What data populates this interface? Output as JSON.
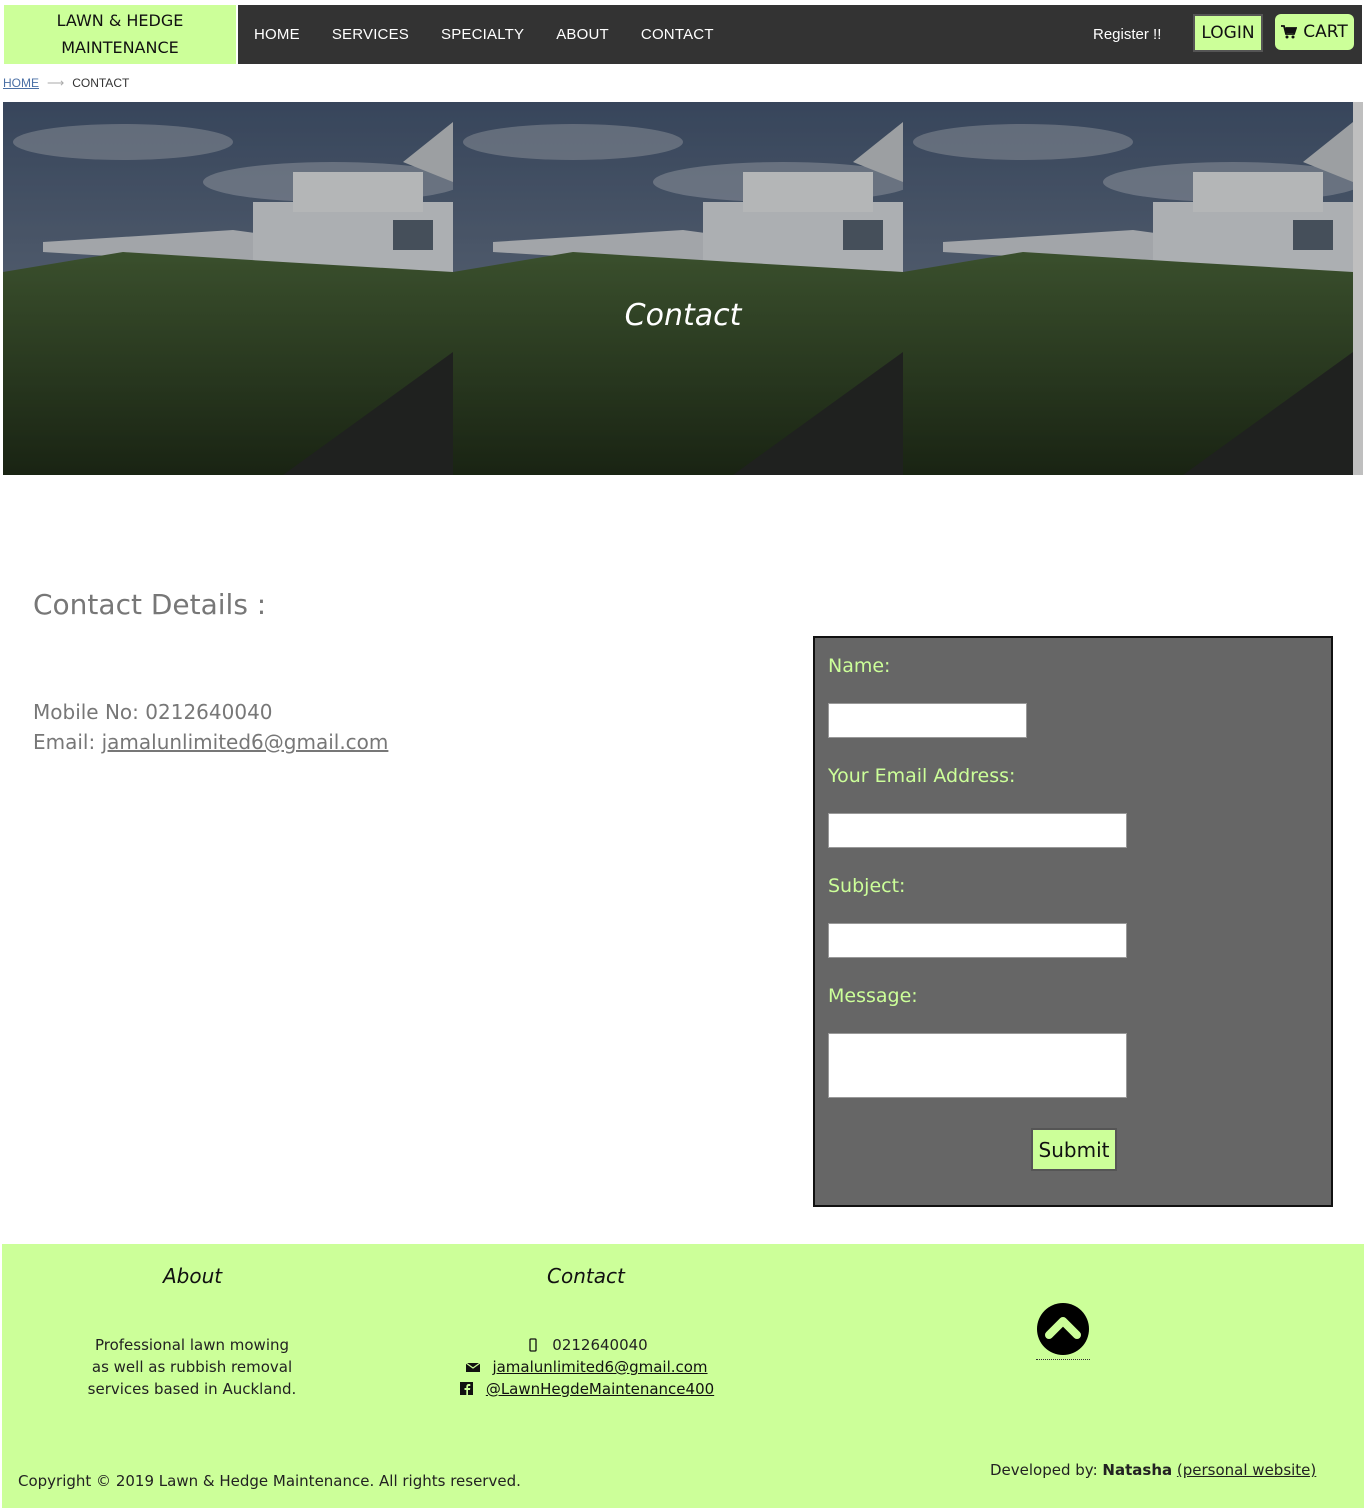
{
  "brand": {
    "line1": "LAWN & HEDGE",
    "line2": "MAINTENANCE"
  },
  "nav": {
    "items": [
      {
        "label": "HOME"
      },
      {
        "label": "SERVICES"
      },
      {
        "label": "SPECIALTY"
      },
      {
        "label": "ABOUT"
      },
      {
        "label": "CONTACT"
      }
    ],
    "register_label": "Register !!",
    "login_label": "LOGIN",
    "cart_label": "CART",
    "cart_icon": "shopping-cart-icon"
  },
  "breadcrumb": {
    "home": "HOME",
    "separator": "⟶",
    "current": "CONTACT"
  },
  "hero": {
    "title": "Contact"
  },
  "details": {
    "title": "Contact Details :",
    "mobile_label": "Mobile No:",
    "mobile_value": "0212640040",
    "email_label": "Email:",
    "email_value": "jamalunlimited6@gmail.com"
  },
  "form": {
    "name_label": "Name:",
    "email_label": "Your Email Address:",
    "subject_label": "Subject:",
    "message_label": "Message:",
    "submit_label": "Submit",
    "name_value": "",
    "email_value": "",
    "subject_value": "",
    "message_value": ""
  },
  "footer": {
    "about_heading": "About",
    "about_line1": "Professional lawn mowing",
    "about_line2": "as well as rubbish removal",
    "about_line3": "services based in Auckland.",
    "contact_heading": "Contact",
    "phone": "0212640040",
    "email": "jamalunlimited6@gmail.com",
    "facebook": "@LawnHegdeMaintenance400",
    "copyright": "Copyright © 2019 Lawn & Hedge Maintenance. All rights reserved.",
    "dev_prefix": "Developed by:",
    "dev_name": "Natasha",
    "dev_link": "(personal website)"
  },
  "colors": {
    "accent": "#ccff99",
    "nav_bg": "#333333",
    "form_bg": "#666666",
    "text_muted": "#777777"
  }
}
